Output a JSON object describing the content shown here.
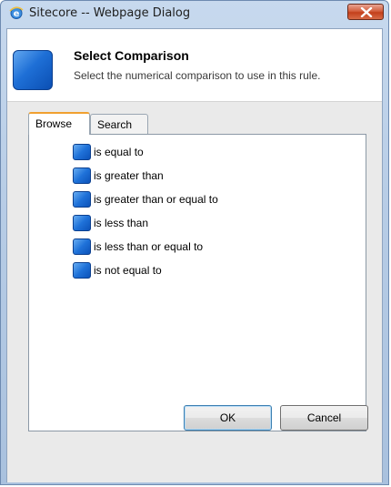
{
  "window": {
    "title": "Sitecore -- Webpage Dialog"
  },
  "header": {
    "title": "Select Comparison",
    "description": "Select the numerical comparison to use in this rule."
  },
  "tabs": [
    {
      "label": "Browse",
      "active": true
    },
    {
      "label": "Search",
      "active": false
    }
  ],
  "items": [
    {
      "label": "is equal to"
    },
    {
      "label": "is greater than"
    },
    {
      "label": "is greater than or equal to"
    },
    {
      "label": "is less than"
    },
    {
      "label": "is less than or equal to"
    },
    {
      "label": "is not equal to"
    }
  ],
  "buttons": {
    "ok": "OK",
    "cancel": "Cancel"
  },
  "colors": {
    "accent_tab": "#f0a030",
    "icon_blue": "#1f72d9",
    "close_red": "#c3401c"
  }
}
